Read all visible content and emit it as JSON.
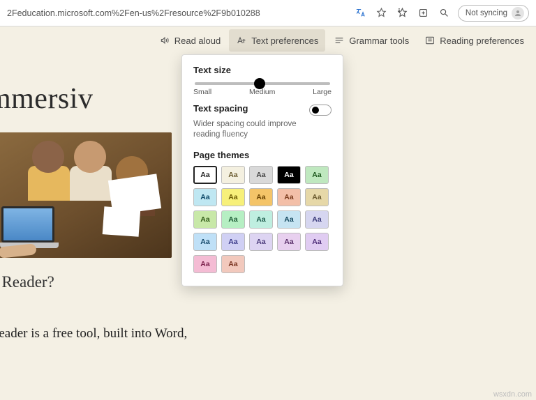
{
  "addressbar": {
    "url": "2Feducation.microsoft.com%2Fen-us%2Fresource%2F9b010288",
    "sync_label": "Not syncing"
  },
  "reader_toolbar": {
    "read_aloud": "Read aloud",
    "text_preferences": "Text preferences",
    "grammar_tools": "Grammar tools",
    "reading_preferences": "Reading preferences"
  },
  "page": {
    "title": "ut the Immersiv",
    "subtitle": "mmersive Reader?",
    "body": "mmersive Reader is a free tool, built into Word,"
  },
  "text_prefs": {
    "text_size_label": "Text size",
    "slider": {
      "min_label": "Small",
      "mid_label": "Medium",
      "max_label": "Large"
    },
    "text_spacing_label": "Text spacing",
    "text_spacing_sub": "Wider spacing could improve reading fluency",
    "page_themes_label": "Page themes",
    "swatch_text": "Aa",
    "themes": [
      {
        "bg": "#ffffff",
        "fg": "#222222",
        "selected": true
      },
      {
        "bg": "#f4f0e0",
        "fg": "#6a5a2e"
      },
      {
        "bg": "#d9d9d9",
        "fg": "#444444"
      },
      {
        "bg": "#000000",
        "fg": "#ffffff"
      },
      {
        "bg": "#bfe8bf",
        "fg": "#1f5a1f"
      },
      {
        "bg": "#bfe7f2",
        "fg": "#0a4666"
      },
      {
        "bg": "#f7f07a",
        "fg": "#6a5a00"
      },
      {
        "bg": "#f4c468",
        "fg": "#6a4300"
      },
      {
        "bg": "#f3bfa8",
        "fg": "#7a3b1d"
      },
      {
        "bg": "#e6d8a8",
        "fg": "#6a5a2e"
      },
      {
        "bg": "#c8e8a8",
        "fg": "#2f5a17"
      },
      {
        "bg": "#b6efc3",
        "fg": "#1b5a34"
      },
      {
        "bg": "#bfeee0",
        "fg": "#1b5a4a"
      },
      {
        "bg": "#c6e4f2",
        "fg": "#14485f"
      },
      {
        "bg": "#d6d6f0",
        "fg": "#3a3a7a"
      },
      {
        "bg": "#bfe0f7",
        "fg": "#14486a"
      },
      {
        "bg": "#d0d0f4",
        "fg": "#3a3a8a"
      },
      {
        "bg": "#ddd4f2",
        "fg": "#4a3a7a"
      },
      {
        "bg": "#e8d0ef",
        "fg": "#5a2f6a"
      },
      {
        "bg": "#e0ccf2",
        "fg": "#4f2f7a"
      },
      {
        "bg": "#f4bcd4",
        "fg": "#7a1f4a"
      },
      {
        "bg": "#f2c9bd",
        "fg": "#7a3522"
      }
    ]
  },
  "watermark": "wsxdn.com"
}
